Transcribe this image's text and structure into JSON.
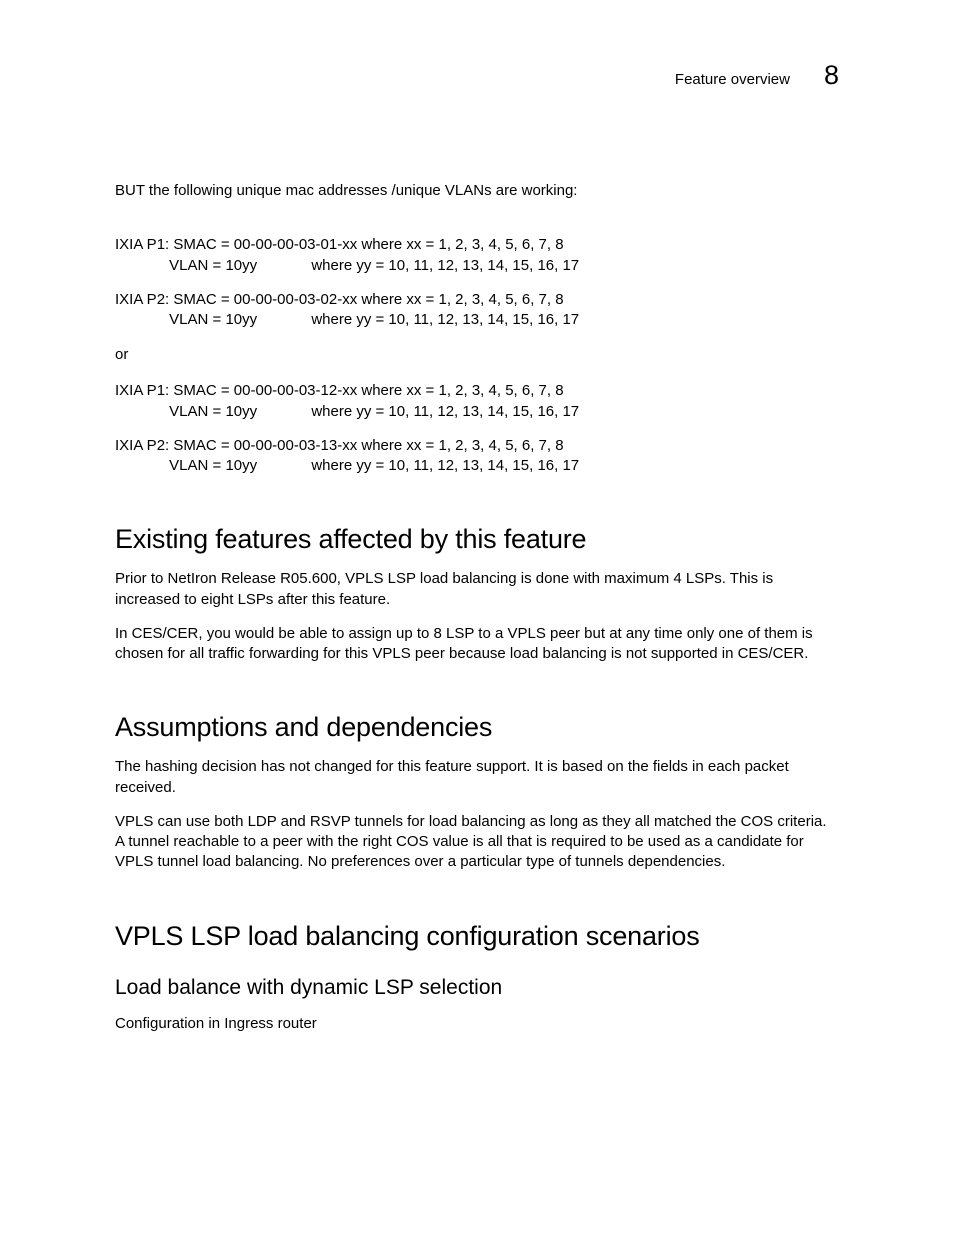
{
  "header": {
    "title": "Feature overview",
    "chapter": "8"
  },
  "intro": "BUT the following unique mac addresses /unique VLANs are working:",
  "block1_l1": "IXIA P1: SMAC = 00-00-00-03-01-xx where xx = 1, 2, 3, 4, 5, 6, 7, 8",
  "block1_l2": "             VLAN = 10yy             where yy = 10, 11, 12, 13, 14, 15, 16, 17",
  "block2_l1": "IXIA P2: SMAC = 00-00-00-03-02-xx where xx = 1, 2, 3, 4, 5, 6, 7, 8",
  "block2_l2": "             VLAN = 10yy             where yy = 10, 11, 12, 13, 14, 15, 16, 17",
  "or": "or",
  "block3_l1": "IXIA P1: SMAC = 00-00-00-03-12-xx where xx = 1, 2, 3, 4, 5, 6, 7, 8",
  "block3_l2": "             VLAN = 10yy             where yy = 10, 11, 12, 13, 14, 15, 16, 17",
  "block4_l1": "IXIA P2: SMAC = 00-00-00-03-13-xx where xx = 1, 2, 3, 4, 5, 6, 7, 8",
  "block4_l2": "             VLAN = 10yy             where yy = 10, 11, 12, 13, 14, 15, 16, 17",
  "sections": {
    "existing": {
      "heading": "Existing features affected by this feature",
      "p1": "Prior to NetIron Release R05.600, VPLS LSP load balancing is done with maximum 4 LSPs. This is increased to eight LSPs after this feature.",
      "p2": "In CES/CER, you would be able to assign up to 8 LSP to a VPLS peer but at any time only one of them is chosen for all traffic forwarding for this VPLS peer because load balancing is not supported in CES/CER."
    },
    "assumptions": {
      "heading": "Assumptions and dependencies",
      "p1": "The hashing decision has not changed for this feature support.  It is based on the fields in each packet received.",
      "p2": "VPLS can use both LDP and RSVP tunnels for load balancing as long as they all matched the COS criteria.  A tunnel reachable to a peer with the right COS value is all that is required to be used as a candidate for VPLS tunnel load balancing. No preferences over a particular type of tunnels dependencies."
    },
    "scenarios": {
      "heading": "VPLS LSP load balancing configuration scenarios",
      "sub1": "Load balance with dynamic LSP selection",
      "p1": "Configuration in Ingress router"
    }
  }
}
